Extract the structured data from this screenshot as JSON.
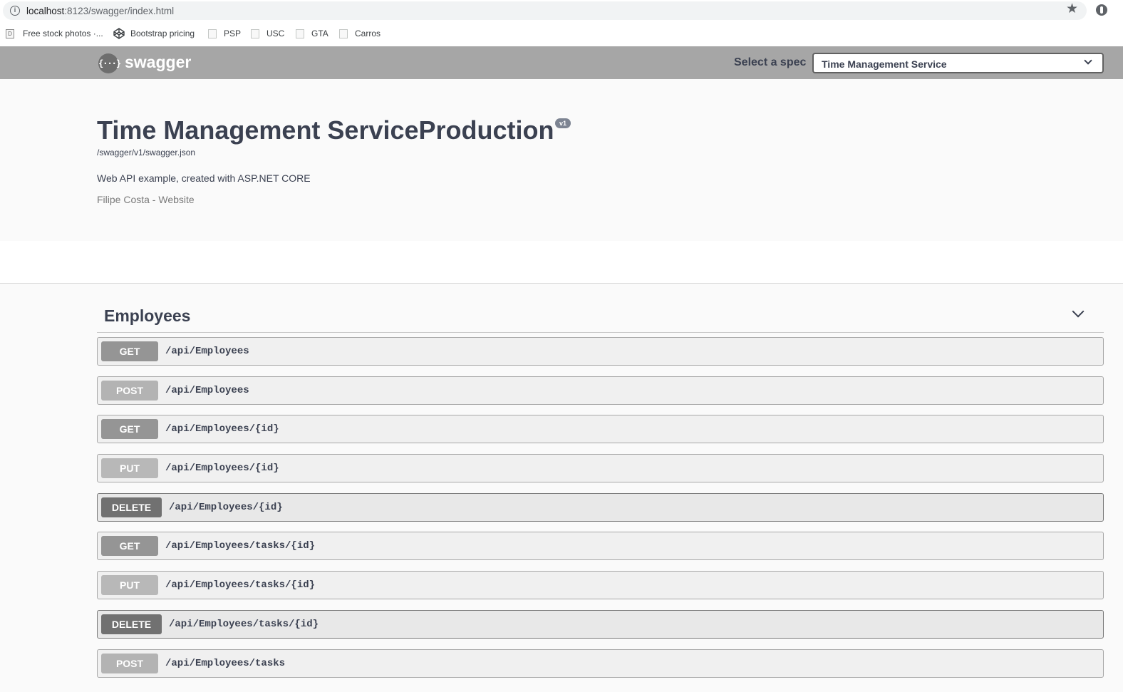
{
  "browser": {
    "url_host": "localhost",
    "url_rest": ":8123/swagger/index.html",
    "bookmarks": [
      {
        "label": "Free stock photos ·..."
      },
      {
        "label": "Bootstrap pricing"
      },
      {
        "label": "PSP"
      },
      {
        "label": "USC"
      },
      {
        "label": "GTA"
      },
      {
        "label": "Carros"
      }
    ]
  },
  "topbar": {
    "logo_glyph": "{···}",
    "logo_text": "swagger",
    "spec_label": "Select a spec",
    "spec_value": "Time Management Service"
  },
  "info": {
    "title": "Time Management ServiceProduction",
    "version": "v1",
    "json_url": "/swagger/v1/swagger.json",
    "description": "Web API example, created with ASP.NET CORE",
    "contact": "Filipe Costa - Website"
  },
  "tag": {
    "name": "Employees",
    "operations": [
      {
        "method": "GET",
        "path": "/api/Employees"
      },
      {
        "method": "POST",
        "path": "/api/Employees"
      },
      {
        "method": "GET",
        "path": "/api/Employees/{id}"
      },
      {
        "method": "PUT",
        "path": "/api/Employees/{id}"
      },
      {
        "method": "DELETE",
        "path": "/api/Employees/{id}"
      },
      {
        "method": "GET",
        "path": "/api/Employees/tasks/{id}"
      },
      {
        "method": "PUT",
        "path": "/api/Employees/tasks/{id}"
      },
      {
        "method": "DELETE",
        "path": "/api/Employees/tasks/{id}"
      },
      {
        "method": "POST",
        "path": "/api/Employees/tasks"
      }
    ]
  },
  "colors": {
    "topbar": "#a6a6a6",
    "get": "#959595",
    "post": "#b3b3b3",
    "put": "#b8b8b8",
    "delete": "#717171"
  }
}
